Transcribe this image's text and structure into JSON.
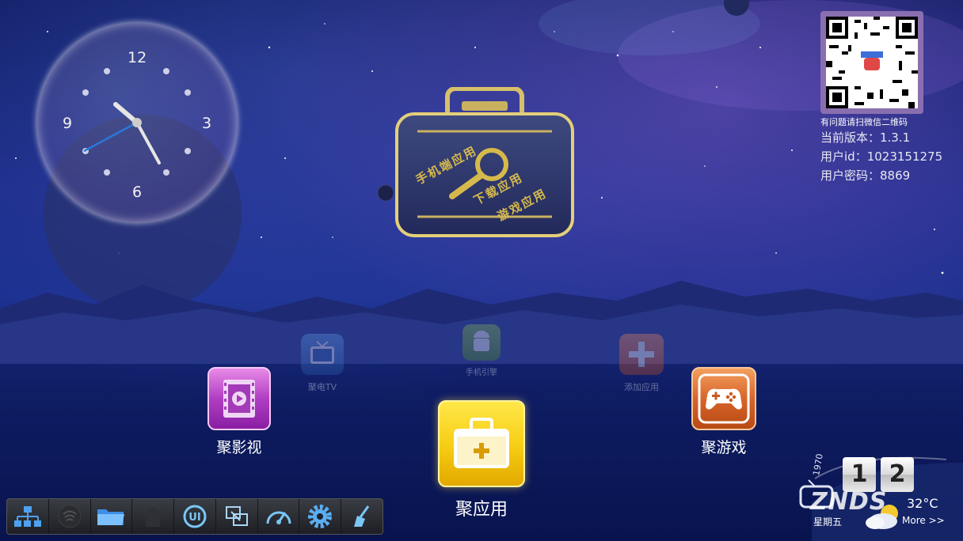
{
  "clock": {
    "n12": "12",
    "n3": "3",
    "n6": "6",
    "n9": "9"
  },
  "featured": {
    "line1": "手机端应用",
    "line2": "下载应用",
    "line3": "游戏应用"
  },
  "qr": {
    "caption": "有问题请扫微信二维码"
  },
  "info": {
    "version": "当前版本：1.3.1",
    "user_id": "用户id：1023151275",
    "user_password": "用户密码：8869"
  },
  "apps": {
    "tv_label": "聚电TV",
    "phone_label": "手机引擎",
    "add_label": "添加应用",
    "video_label": "聚影视",
    "apps_label": "聚应用",
    "games_label": "聚游戏"
  },
  "weather": {
    "digit1": "1",
    "digit2": "2",
    "year_fragment": "1970",
    "weekday": "星期五",
    "temperature": "32°C",
    "more": "More >>",
    "watermark": "ZNDS"
  },
  "taskbar": {
    "items": [
      "network-icon",
      "wireless-icon",
      "folder-icon",
      "home-icon",
      "ui-icon",
      "screen-mirror-icon",
      "speed-test-icon",
      "settings-icon",
      "cleaner-icon"
    ]
  }
}
